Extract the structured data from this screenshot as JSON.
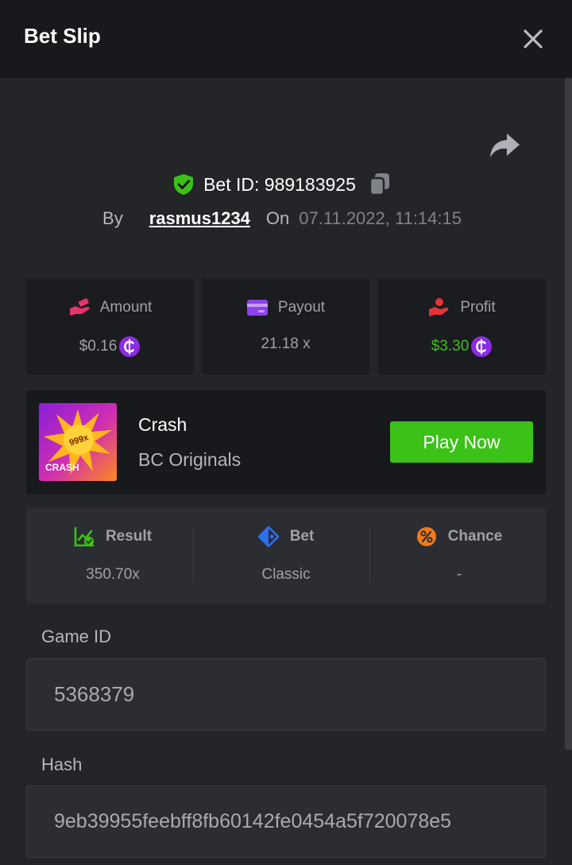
{
  "header": {
    "title": "Bet Slip",
    "close_icon": "close-icon"
  },
  "share": {
    "icon": "share-icon"
  },
  "bet": {
    "id_label": "Bet ID: 989183925",
    "by_label": "By",
    "username": "rasmus1234",
    "on_label": "On",
    "datetime": "07.11.2022, 11:14:15"
  },
  "stats": {
    "amount": {
      "label": "Amount",
      "value": "$0.16",
      "icon": "money-hand-icon"
    },
    "payout": {
      "label": "Payout",
      "value": "21.18 x",
      "icon": "card-icon"
    },
    "profit": {
      "label": "Profit",
      "value": "$3.30",
      "icon": "profit-hand-icon",
      "color": "#3bc117"
    }
  },
  "game": {
    "name": "Crash",
    "provider": "BC Originals",
    "play_label": "Play Now",
    "thumb_multiplier": "999x",
    "thumb_title": "CRASH"
  },
  "info": {
    "result": {
      "label": "Result",
      "value": "350.70x",
      "icon": "chart-check-icon"
    },
    "bet": {
      "label": "Bet",
      "value": "Classic",
      "icon": "tag-icon"
    },
    "chance": {
      "label": "Chance",
      "value": "-",
      "icon": "percent-icon"
    }
  },
  "fields": {
    "game_id": {
      "label": "Game ID",
      "value": "5368379"
    },
    "hash": {
      "label": "Hash",
      "value": "9eb39955feebff8fb60142fe0454a5f720078e5"
    }
  },
  "colors": {
    "background": "#232529",
    "header": "#18191c",
    "accent_green": "#3bc117",
    "coin_purple": "#8b2be2"
  }
}
